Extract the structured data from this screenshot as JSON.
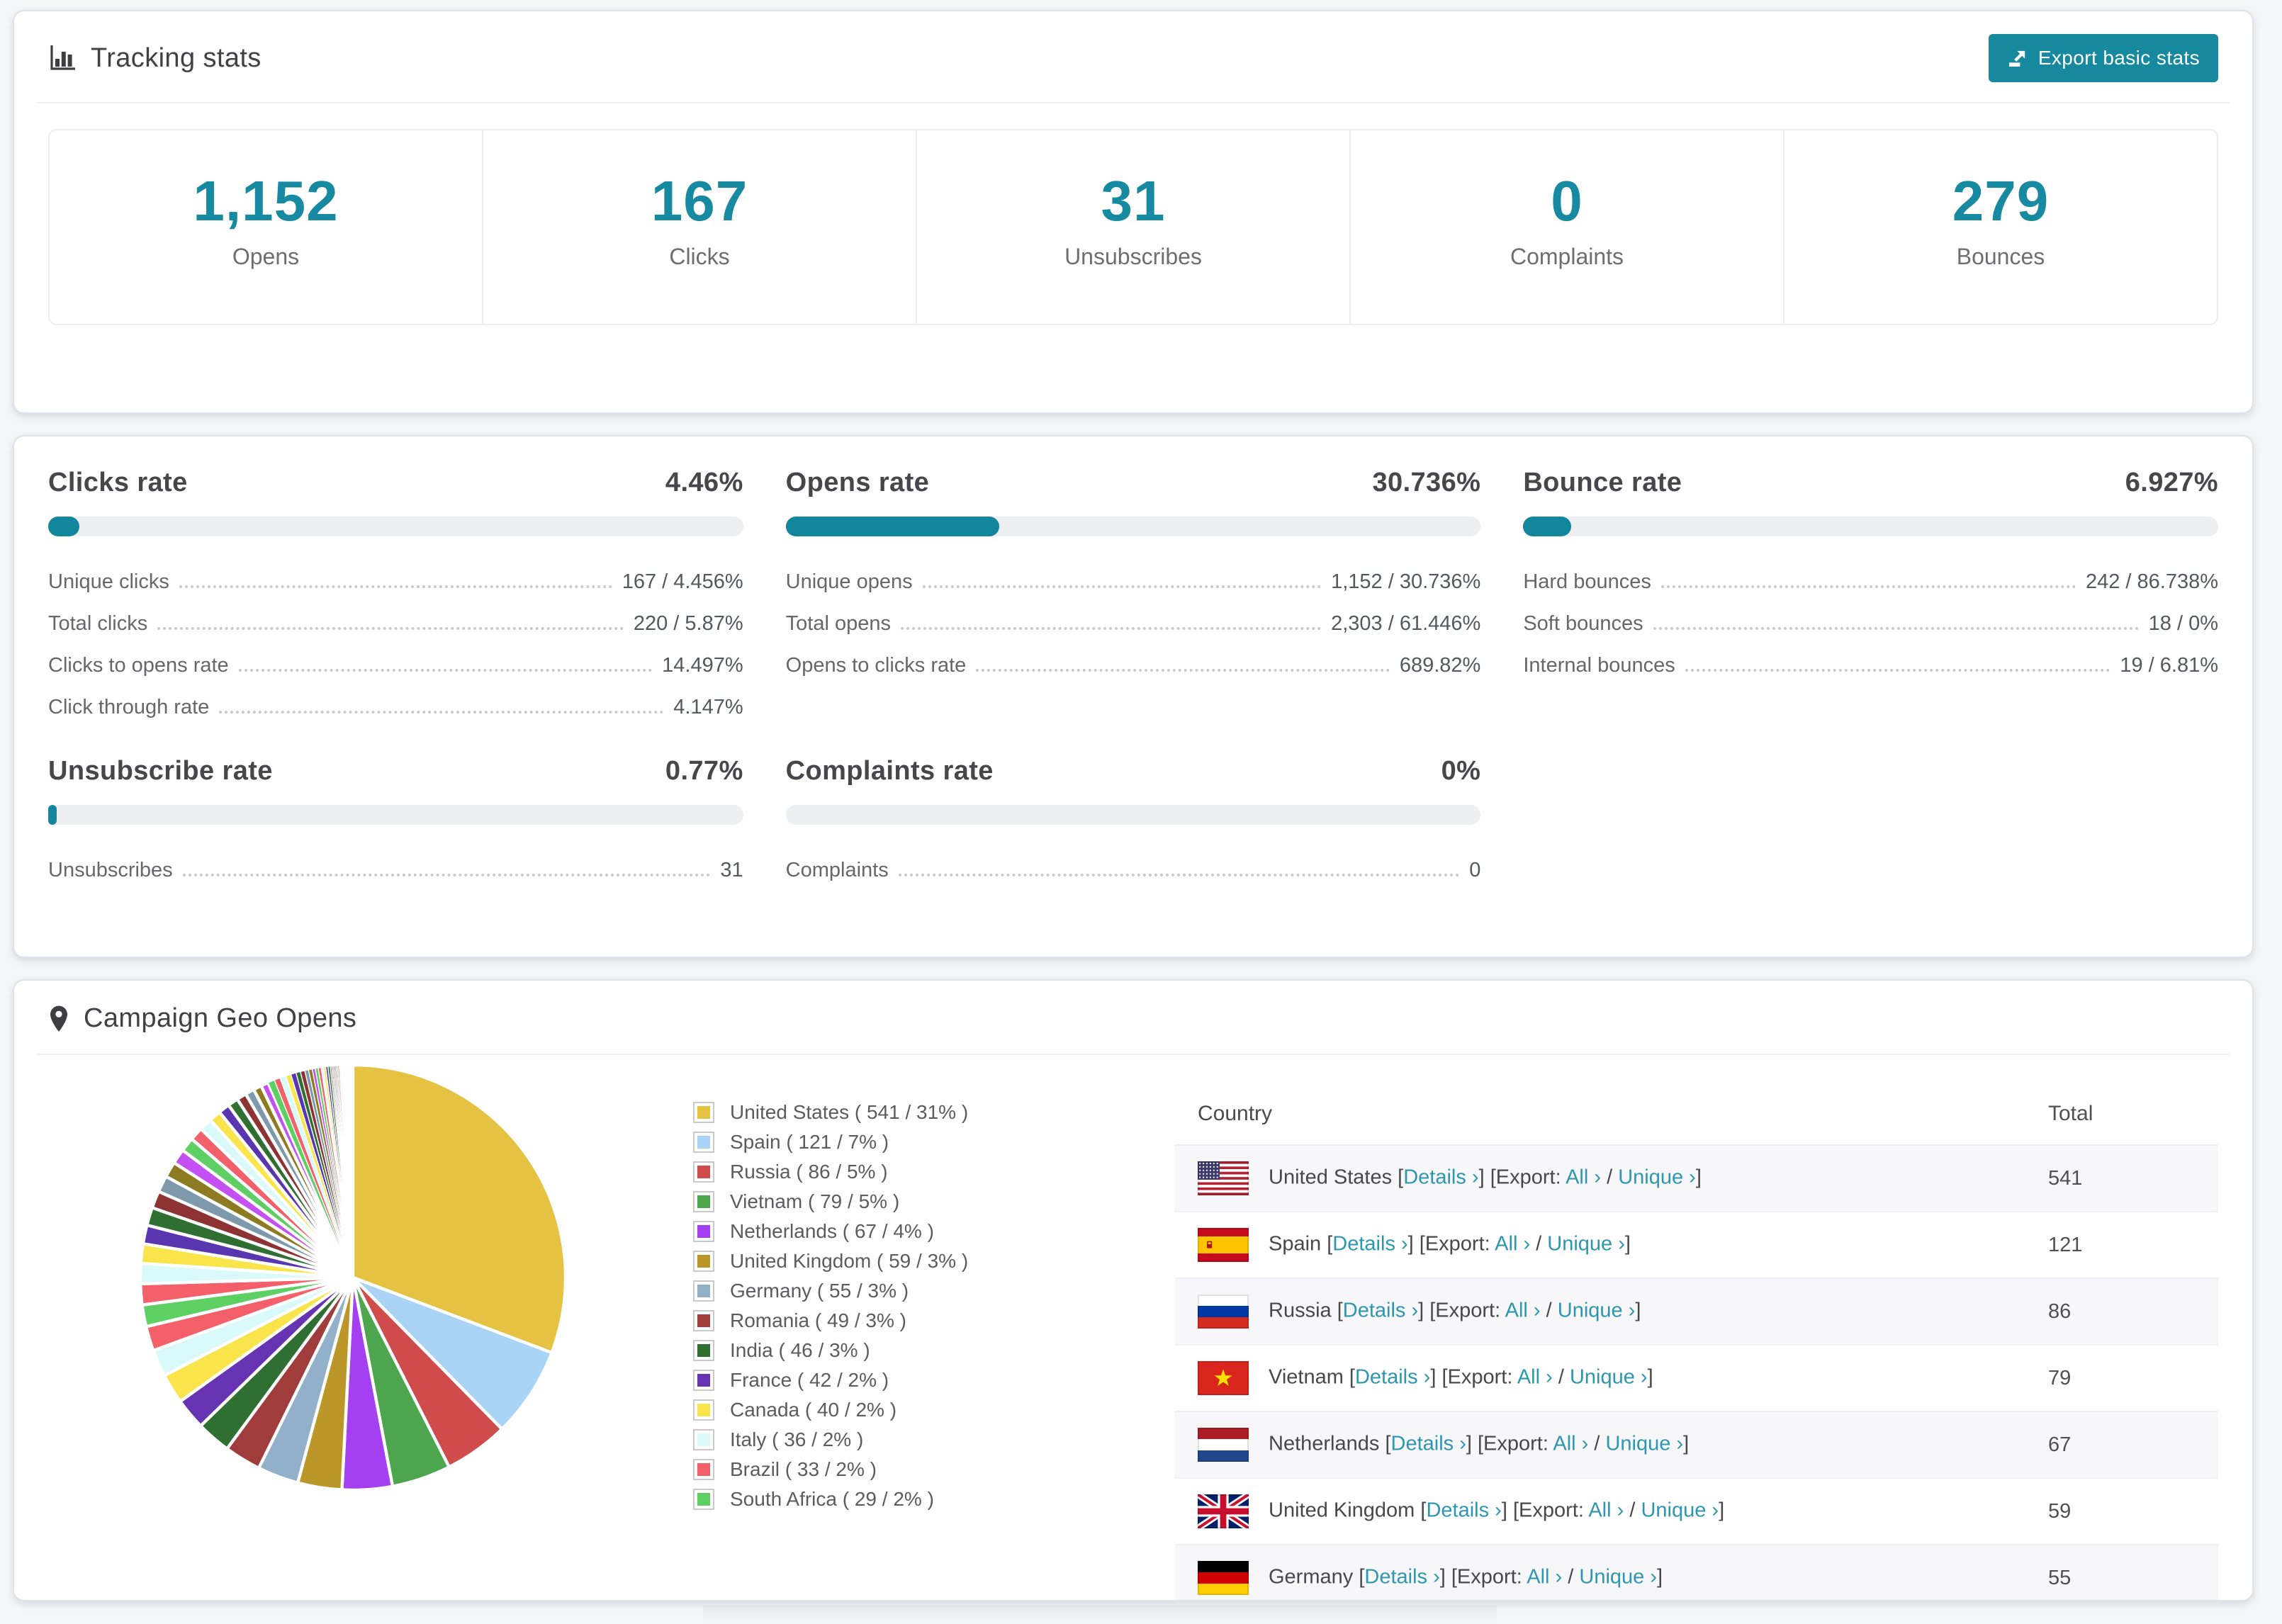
{
  "accent": {
    "teal": "#17899e",
    "link": "#2d96b0",
    "number_teal": "#1789a1"
  },
  "tracking": {
    "title": "Tracking stats",
    "export_button": "Export basic stats",
    "stats": [
      {
        "value": "1,152",
        "label": "Opens"
      },
      {
        "value": "167",
        "label": "Clicks"
      },
      {
        "value": "31",
        "label": "Unsubscribes"
      },
      {
        "value": "0",
        "label": "Complaints"
      },
      {
        "value": "279",
        "label": "Bounces"
      }
    ]
  },
  "rates": [
    {
      "title": "Clicks rate",
      "value": "4.46%",
      "percent": 4.46,
      "rows": [
        [
          "Unique clicks",
          "167 / 4.456%"
        ],
        [
          "Total clicks",
          "220 / 5.87%"
        ],
        [
          "Clicks to opens rate",
          "14.497%"
        ],
        [
          "Click through rate",
          "4.147%"
        ]
      ]
    },
    {
      "title": "Opens rate",
      "value": "30.736%",
      "percent": 30.736,
      "rows": [
        [
          "Unique opens",
          "1,152 / 30.736%"
        ],
        [
          "Total opens",
          "2,303 / 61.446%"
        ],
        [
          "Opens to clicks rate",
          "689.82%"
        ]
      ]
    },
    {
      "title": "Bounce rate",
      "value": "6.927%",
      "percent": 6.927,
      "rows": [
        [
          "Hard bounces",
          "242 / 86.738%"
        ],
        [
          "Soft bounces",
          "18 / 0%"
        ],
        [
          "Internal bounces",
          "19 / 6.81%"
        ]
      ]
    },
    {
      "title": "Unsubscribe rate",
      "value": "0.77%",
      "percent": 0.77,
      "rows": [
        [
          "Unsubscribes",
          "31"
        ]
      ]
    },
    {
      "title": "Complaints rate",
      "value": "0%",
      "percent": 0,
      "rows": [
        [
          "Complaints",
          "0"
        ]
      ]
    }
  ],
  "geo": {
    "title": "Campaign Geo Opens",
    "columns": [
      "Country",
      "Total"
    ],
    "links": {
      "details": "Details ›",
      "all": "All ›",
      "unique": "Unique ›"
    },
    "row_segments": {
      "pre": "[",
      "mid": "] [Export: ",
      "sep": " / ",
      "end": "]"
    },
    "rows": [
      {
        "flag": "us",
        "country": "United States",
        "total": "541"
      },
      {
        "flag": "es",
        "country": "Spain",
        "total": "121"
      },
      {
        "flag": "ru",
        "country": "Russia",
        "total": "86"
      },
      {
        "flag": "vn",
        "country": "Vietnam",
        "total": "79"
      },
      {
        "flag": "nl",
        "country": "Netherlands",
        "total": "67"
      },
      {
        "flag": "gb",
        "country": "United Kingdom",
        "total": "59"
      },
      {
        "flag": "de",
        "country": "Germany",
        "total": "55"
      }
    ]
  },
  "chart_data": {
    "type": "pie",
    "title": "Campaign Geo Opens",
    "legend_position": "right",
    "legend_format": "{name} ( {value} / {pct} )",
    "series": [
      {
        "name": "United States",
        "value": 541,
        "pct": "31%",
        "color": "#e6c243"
      },
      {
        "name": "Spain",
        "value": 121,
        "pct": "7%",
        "color": "#aad4f5"
      },
      {
        "name": "Russia",
        "value": 86,
        "pct": "5%",
        "color": "#d04b4b"
      },
      {
        "name": "Vietnam",
        "value": 79,
        "pct": "5%",
        "color": "#4da64d"
      },
      {
        "name": "Netherlands",
        "value": 67,
        "pct": "4%",
        "color": "#a43ff2"
      },
      {
        "name": "United Kingdom",
        "value": 59,
        "pct": "3%",
        "color": "#bb9629"
      },
      {
        "name": "Germany",
        "value": 55,
        "pct": "3%",
        "color": "#92b0ca"
      },
      {
        "name": "Romania",
        "value": 49,
        "pct": "3%",
        "color": "#a03c3c"
      },
      {
        "name": "India",
        "value": 46,
        "pct": "3%",
        "color": "#2f7032"
      },
      {
        "name": "France",
        "value": 42,
        "pct": "2%",
        "color": "#6633b2"
      },
      {
        "name": "Canada",
        "value": 40,
        "pct": "2%",
        "color": "#f9e44c"
      },
      {
        "name": "Italy",
        "value": 36,
        "pct": "2%",
        "color": "#d9f9fb"
      },
      {
        "name": "Brazil",
        "value": 33,
        "pct": "2%",
        "color": "#f4606a"
      },
      {
        "name": "South Africa",
        "value": 29,
        "pct": "2%",
        "color": "#5ecf63"
      }
    ],
    "others_values": [
      28,
      27,
      26,
      25,
      24,
      23,
      22,
      21,
      20,
      19,
      18,
      17,
      16,
      15,
      14,
      13,
      12,
      11,
      10,
      9,
      8,
      8,
      7,
      7,
      6,
      6,
      5,
      5,
      4,
      4,
      4,
      3,
      3,
      3,
      3,
      2,
      2,
      2,
      2,
      2,
      2,
      2,
      1,
      1,
      1,
      1,
      1,
      1,
      1,
      1,
      1,
      1,
      1,
      1,
      1,
      1,
      1,
      1
    ],
    "others_palette": [
      "#f4606a",
      "#d9f9fb",
      "#f9e44c",
      "#5a35b0",
      "#2f7032",
      "#8d3333",
      "#7e99ac",
      "#8d7b22",
      "#c44ff2",
      "#5ecf63"
    ]
  }
}
